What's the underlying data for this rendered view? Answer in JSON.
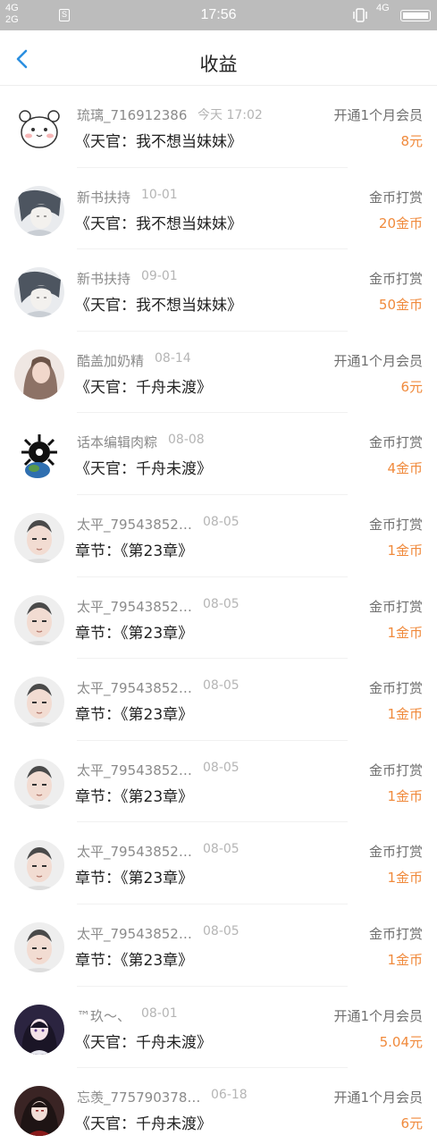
{
  "status_bar": {
    "net_top": "4G",
    "net_bottom": "2G",
    "sim_label": "S",
    "time": "17:56",
    "net_right": "4G",
    "icons": [
      "signal-icon",
      "sim-icon",
      "vibrate-icon",
      "battery-icon"
    ]
  },
  "header": {
    "title": "收益",
    "back_icon": "chevron-left-icon",
    "accent_color": "#2b8fe0"
  },
  "colors": {
    "amount": "#f08a3c",
    "name": "#8a8a8a",
    "date": "#b5b5b5",
    "type": "#6f6f6f"
  },
  "items": [
    {
      "name": "琉璃_716912386",
      "date": "今天 17:02",
      "title": "《天官：我不想当妹妹》",
      "type": "开通1个月会员",
      "amount": "8元",
      "avatar": "cartoon-bear"
    },
    {
      "name": "新书扶持",
      "date": "10-01",
      "title": "《天官：我不想当妹妹》",
      "type": "金币打赏",
      "amount": "20金币",
      "avatar": "ink-portrait"
    },
    {
      "name": "新书扶持",
      "date": "09-01",
      "title": "《天官：我不想当妹妹》",
      "type": "金币打赏",
      "amount": "50金币",
      "avatar": "ink-portrait"
    },
    {
      "name": "酷盖加奶精",
      "date": "08-14",
      "title": "《天官：千舟未渡》",
      "type": "开通1个月会员",
      "amount": "6元",
      "avatar": "girl-photo"
    },
    {
      "name": "话本编辑肉粽",
      "date": "08-08",
      "title": "《天官：千舟未渡》",
      "type": "金币打赏",
      "amount": "4金币",
      "avatar": "dark-emblem"
    },
    {
      "name": "太平_79543852…",
      "date": "08-05",
      "title": "章节：《第23章》",
      "type": "金币打赏",
      "amount": "1金币",
      "avatar": "face-photo"
    },
    {
      "name": "太平_79543852…",
      "date": "08-05",
      "title": "章节：《第23章》",
      "type": "金币打赏",
      "amount": "1金币",
      "avatar": "face-photo"
    },
    {
      "name": "太平_79543852…",
      "date": "08-05",
      "title": "章节：《第23章》",
      "type": "金币打赏",
      "amount": "1金币",
      "avatar": "face-photo"
    },
    {
      "name": "太平_79543852…",
      "date": "08-05",
      "title": "章节：《第23章》",
      "type": "金币打赏",
      "amount": "1金币",
      "avatar": "face-photo"
    },
    {
      "name": "太平_79543852…",
      "date": "08-05",
      "title": "章节：《第23章》",
      "type": "金币打赏",
      "amount": "1金币",
      "avatar": "face-photo"
    },
    {
      "name": "太平_79543852…",
      "date": "08-05",
      "title": "章节：《第23章》",
      "type": "金币打赏",
      "amount": "1金币",
      "avatar": "face-photo"
    },
    {
      "name": "™玖～、",
      "date": "08-01",
      "title": "《天官：千舟未渡》",
      "type": "开通1个月会员",
      "amount": "5.04元",
      "avatar": "anime-girl"
    },
    {
      "name": "忘羡_775790378…",
      "date": "06-18",
      "title": "《天官：千舟未渡》",
      "type": "开通1个月会员",
      "amount": "6元",
      "avatar": "anime-dark"
    }
  ]
}
